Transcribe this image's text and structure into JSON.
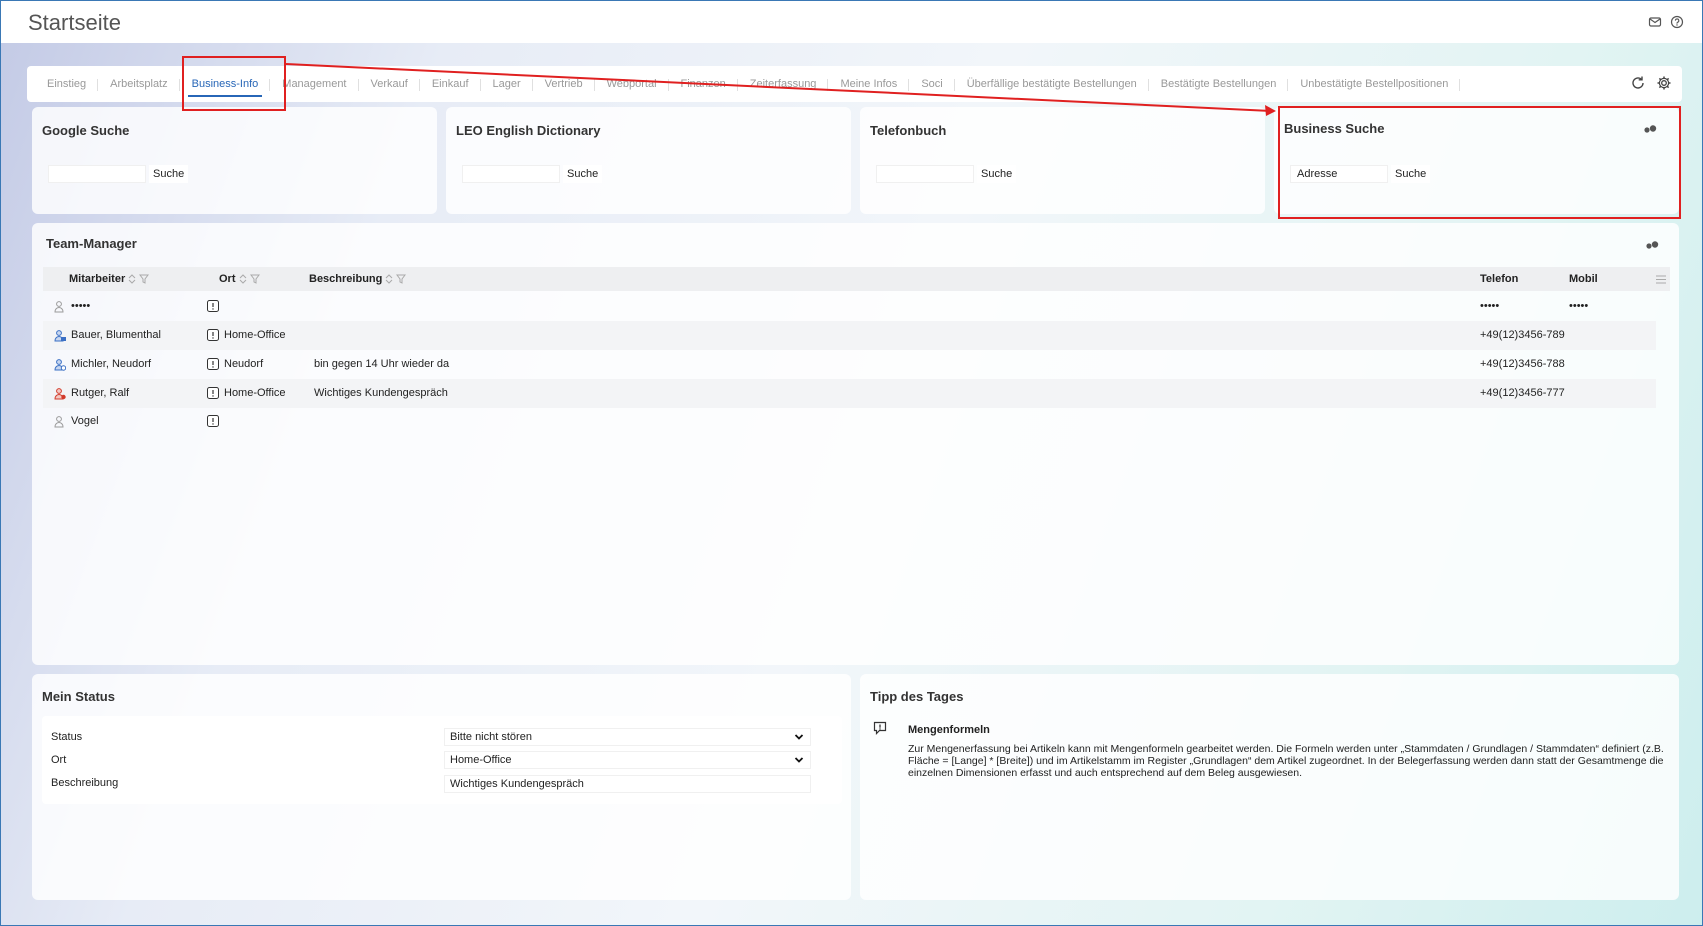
{
  "header": {
    "title": "Startseite"
  },
  "tabs": [
    {
      "label": "Einstieg",
      "active": false
    },
    {
      "label": "Arbeitsplatz",
      "active": false
    },
    {
      "label": "Business-Info",
      "active": true
    },
    {
      "label": "Management",
      "active": false
    },
    {
      "label": "Verkauf",
      "active": false
    },
    {
      "label": "Einkauf",
      "active": false
    },
    {
      "label": "Lager",
      "active": false
    },
    {
      "label": "Vertrieb",
      "active": false
    },
    {
      "label": "Webportal",
      "active": false
    },
    {
      "label": "Finanzen",
      "active": false
    },
    {
      "label": "Zeiterfassung",
      "active": false
    },
    {
      "label": "Meine Infos",
      "active": false
    },
    {
      "label": "Soci",
      "active": false
    },
    {
      "label": "Überfällige bestätigte Bestellungen",
      "active": false
    },
    {
      "label": "Bestätigte Bestellungen",
      "active": false
    },
    {
      "label": "Unbestätigte Bestellpositionen",
      "active": false
    }
  ],
  "google": {
    "title": "Google Suche",
    "button": "Suche",
    "value": ""
  },
  "leo": {
    "title": "LEO English Dictionary",
    "button": "Suche",
    "value": ""
  },
  "telefonbuch": {
    "title": "Telefonbuch",
    "button": "Suche",
    "value": ""
  },
  "business": {
    "title": "Business Suche",
    "button": "Suche",
    "value": "Adresse"
  },
  "team": {
    "title": "Team-Manager",
    "columns": {
      "mitarbeiter": "Mitarbeiter",
      "ort": "Ort",
      "beschreibung": "Beschreibung",
      "telefon": "Telefon",
      "mobil": "Mobil"
    },
    "rows": [
      {
        "name": "•••••",
        "ort": "",
        "beschreibung": "",
        "telefon": "•••••",
        "mobil": "•••••",
        "avatar_color": "#9a9a9a"
      },
      {
        "name": "Bauer, Blumenthal",
        "ort": "Home-Office",
        "beschreibung": "",
        "telefon": "+49(12)3456-789",
        "mobil": "",
        "avatar_color": "#3a6fc4"
      },
      {
        "name": "Michler, Neudorf",
        "ort": "Neudorf",
        "beschreibung": "bin gegen 14 Uhr wieder da",
        "telefon": "+49(12)3456-788",
        "mobil": "",
        "avatar_color": "#3a6fc4"
      },
      {
        "name": "Rutger, Ralf",
        "ort": "Home-Office",
        "beschreibung": "Wichtiges Kundengespräch",
        "telefon": "+49(12)3456-777",
        "mobil": "",
        "avatar_color": "#d23a2a"
      },
      {
        "name": "Vogel",
        "ort": "",
        "beschreibung": "",
        "telefon": "",
        "mobil": "",
        "avatar_color": "#9a9a9a"
      }
    ]
  },
  "status": {
    "title": "Mein Status",
    "status_label": "Status",
    "status_value": "Bitte nicht stören",
    "ort_label": "Ort",
    "ort_value": "Home-Office",
    "beschreibung_label": "Beschreibung",
    "beschreibung_value": "Wichtiges Kundengespräch"
  },
  "tipp": {
    "title": "Tipp des Tages",
    "heading": "Mengenformeln",
    "text": "Zur Mengenerfassung bei Artikeln kann mit Mengenformeln gearbeitet werden. Die Formeln werden unter „Stammdaten / Grundlagen / Stammdaten“ definiert (z.B. Fläche = [Lange] * [Breite]) und im Artikelstamm im Register „Grundlagen“ dem Artikel zugeordnet. In der Belegerfassung werden dann statt der Gesamtmenge die einzelnen Dimensionen erfasst und auch entsprechend auf dem Beleg ausgewiesen."
  },
  "colors": {
    "accent": "#2766b7",
    "annotation": "#e02020"
  }
}
